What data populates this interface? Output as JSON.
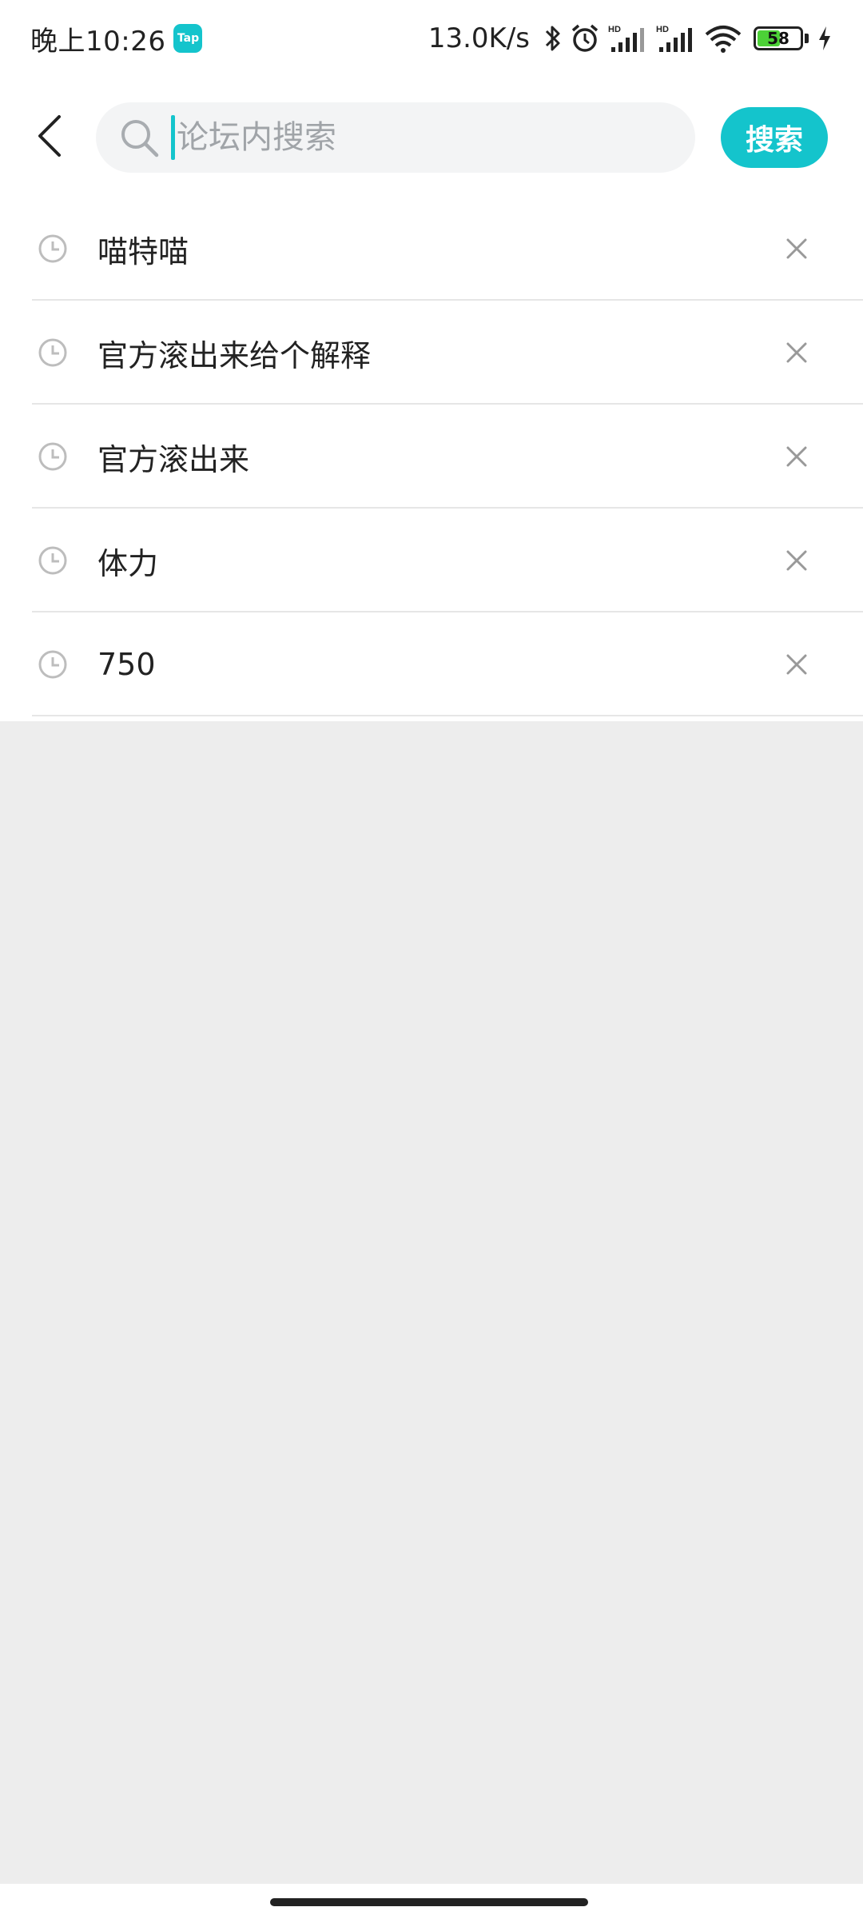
{
  "status_bar": {
    "time": "晚上10:26",
    "app_badge": "Tap",
    "net_speed": "13.0K/s",
    "battery": {
      "level": 58,
      "label": "58",
      "charging": true
    },
    "icons": [
      "bluetooth-icon",
      "alarm-icon",
      "signal-hd-icon",
      "signal-hd-icon",
      "wifi-icon",
      "battery-icon",
      "charging-icon"
    ]
  },
  "search": {
    "placeholder": "论坛内搜索",
    "value": "",
    "button_label": "搜索"
  },
  "history": [
    {
      "text": "喵特喵"
    },
    {
      "text": "官方滚出来给个解释"
    },
    {
      "text": "官方滚出来"
    },
    {
      "text": "体力"
    },
    {
      "text": "750"
    }
  ],
  "colors": {
    "accent": "#14c4cc",
    "background": "#ededed",
    "surface": "#ffffff",
    "placeholder": "#a0a4a8"
  }
}
